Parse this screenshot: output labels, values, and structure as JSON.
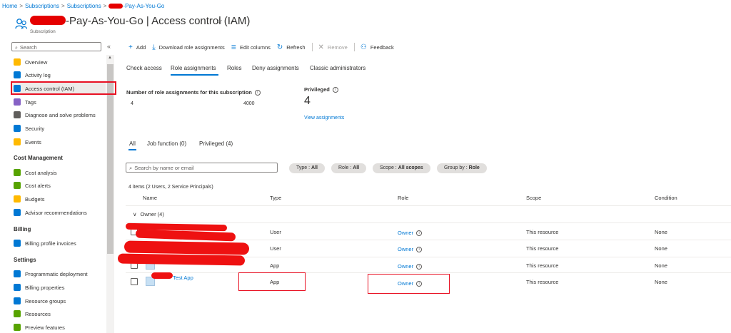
{
  "breadcrumb": {
    "items": [
      "Home",
      "Subscriptions",
      "Subscriptions"
    ],
    "current_suffix": "-Pay-As-You-Go"
  },
  "header": {
    "title_suffix": "-Pay-As-You-Go",
    "title_separator": " | ",
    "page": "Access control (IAM)",
    "subtitle": "Subscription",
    "star": "☆",
    "more": "···"
  },
  "sidebar": {
    "search_placeholder": "Search",
    "collapse": "«",
    "items": [
      {
        "label": "Overview",
        "icon": "key-icon",
        "color": "#ffb900"
      },
      {
        "label": "Activity log",
        "icon": "log-icon",
        "color": "#0078d4"
      },
      {
        "label": "Access control (IAM)",
        "icon": "people-icon",
        "color": "#0078d4"
      },
      {
        "label": "Tags",
        "icon": "tag-icon",
        "color": "#8661c5"
      },
      {
        "label": "Diagnose and solve problems",
        "icon": "wrench-icon",
        "color": "#605e5c"
      },
      {
        "label": "Security",
        "icon": "shield-icon",
        "color": "#0078d4"
      },
      {
        "label": "Events",
        "icon": "bolt-icon",
        "color": "#ffb900"
      }
    ],
    "sections": [
      {
        "title": "Cost Management",
        "items": [
          {
            "label": "Cost analysis",
            "icon": "dollar-icon",
            "color": "#57a300"
          },
          {
            "label": "Cost alerts",
            "icon": "alert-icon",
            "color": "#57a300"
          },
          {
            "label": "Budgets",
            "icon": "budget-icon",
            "color": "#ffb900"
          },
          {
            "label": "Advisor recommendations",
            "icon": "cloud-icon",
            "color": "#0078d4"
          }
        ]
      },
      {
        "title": "Billing",
        "items": [
          {
            "label": "Billing profile invoices",
            "icon": "invoice-icon",
            "color": "#0078d4"
          }
        ]
      },
      {
        "title": "Settings",
        "items": [
          {
            "label": "Programmatic deployment",
            "icon": "bag-icon",
            "color": "#0078d4"
          },
          {
            "label": "Billing properties",
            "icon": "bars-icon",
            "color": "#0078d4"
          },
          {
            "label": "Resource groups",
            "icon": "cube-icon",
            "color": "#0078d4"
          },
          {
            "label": "Resources",
            "icon": "grid-icon",
            "color": "#57a300"
          },
          {
            "label": "Preview features",
            "icon": "preview-icon",
            "color": "#57a300"
          }
        ]
      }
    ]
  },
  "toolbar": {
    "add": "Add",
    "download": "Download role assignments",
    "edit_columns": "Edit columns",
    "refresh": "Refresh",
    "remove": "Remove",
    "feedback": "Feedback"
  },
  "tabs": [
    "Check access",
    "Role assignments",
    "Roles",
    "Deny assignments",
    "Classic administrators"
  ],
  "stats": {
    "count_label": "Number of role assignments for this subscription",
    "count_current": "4",
    "count_max": "4000",
    "privileged_label": "Privileged",
    "privileged_value": "4",
    "view_link": "View assignments"
  },
  "filter_tabs": [
    "All",
    "Job function (0)",
    "Privileged (4)"
  ],
  "name_search_placeholder": "Search by name or email",
  "pills": [
    {
      "key": "Type : ",
      "value": "All"
    },
    {
      "key": "Role : ",
      "value": "All"
    },
    {
      "key": "Scope : ",
      "value": "All scopes"
    },
    {
      "key": "Group by : ",
      "value": "Role"
    }
  ],
  "items_count": "4 items (2 Users, 2 Service Principals)",
  "table": {
    "headers": [
      "Name",
      "Type",
      "Role",
      "Scope",
      "Condition"
    ],
    "group": "Owner (4)",
    "rows": [
      {
        "name": "",
        "type": "User",
        "role": "Owner",
        "scope": "This resource",
        "condition": "None"
      },
      {
        "name": "",
        "type": "User",
        "role": "Owner",
        "scope": "This resource",
        "condition": "None"
      },
      {
        "name": "",
        "type": "App",
        "role": "Owner",
        "scope": "This resource",
        "condition": "None"
      },
      {
        "name": "Test App",
        "type": "App",
        "role": "Owner",
        "scope": "This resource",
        "condition": "None"
      }
    ]
  },
  "info_glyph": "i"
}
